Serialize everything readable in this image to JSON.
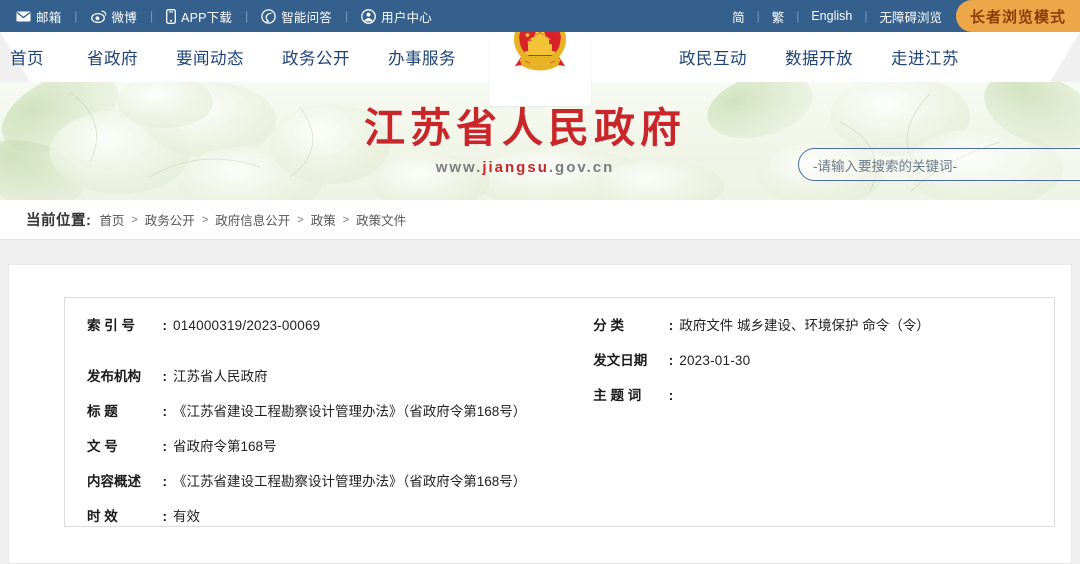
{
  "topbar": {
    "left_items": [
      {
        "icon": "mail-icon",
        "label": "邮箱"
      },
      {
        "icon": "weibo-icon",
        "label": "微博"
      },
      {
        "icon": "mobile-icon",
        "label": "APP下载"
      },
      {
        "icon": "qa-icon",
        "label": "智能问答"
      },
      {
        "icon": "user-icon",
        "label": "用户中心"
      }
    ],
    "right_items": [
      "简",
      "繁",
      "English",
      "无障碍浏览"
    ],
    "elder_mode_label": "长者浏览模式",
    "separator": "|",
    "colors": {
      "bar_bg": "#35608e",
      "elder_bg": "#eda749",
      "elder_text": "#8a3d06"
    }
  },
  "nav": {
    "left_links": [
      "首页",
      "省政府",
      "要闻动态",
      "政务公开",
      "办事服务"
    ],
    "right_links": [
      "政民互动",
      "数据开放",
      "走进江苏"
    ],
    "emblem": "national-emblem",
    "link_color": "#20447a"
  },
  "banner": {
    "title": "江苏省人民政府",
    "url_prefix": "www.",
    "url_highlight": "jiangsu",
    "url_suffix": ".gov.cn",
    "title_color": "#c9262a"
  },
  "search": {
    "placeholder": "-请输入要搜索的关键词-",
    "button_icon": "search-icon"
  },
  "breadcrumb": {
    "label": "当前位置:",
    "items": [
      "首页",
      "政务公开",
      "政府信息公开",
      "政策",
      "政策文件"
    ],
    "separator": ">"
  },
  "document_meta": {
    "left": [
      {
        "key": "索  引  号",
        "key_chars": "索 引 号",
        "value": "014000319/2023-00069",
        "spacer": true
      },
      {
        "key": "发 布 机 构",
        "key_chars": "发布机构",
        "value": "江苏省人民政府"
      },
      {
        "key": "标      题",
        "key_chars": "标 题",
        "value": "《江苏省建设工程勘察设计管理办法》（省政府令第168号）"
      },
      {
        "key": "文      号",
        "key_chars": "文 号",
        "value": "省政府令第168号"
      },
      {
        "key": "内 容 概 述",
        "key_chars": "内容概述",
        "value": "《江苏省建设工程勘察设计管理办法》（省政府令第168号）"
      },
      {
        "key": "时      效",
        "key_chars": "时 效",
        "value": "有效"
      }
    ],
    "right": [
      {
        "key": "分      类",
        "key_chars": "分 类",
        "value": "政府文件 城乡建设、环境保护 命令（令）"
      },
      {
        "key": "发 文 日 期",
        "key_chars": "发文日期",
        "value": "2023-01-30"
      },
      {
        "key": "主  题  词",
        "key_chars": "主 题 词",
        "value": ""
      }
    ]
  }
}
